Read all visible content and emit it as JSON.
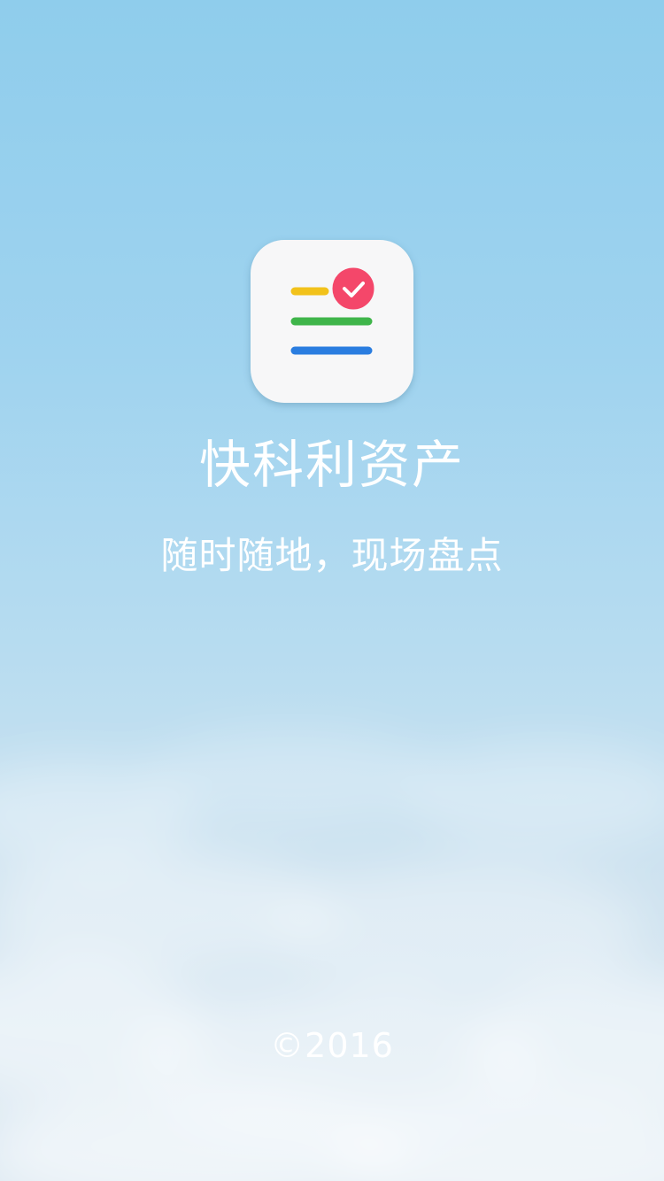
{
  "splash": {
    "app_name": "快科利资产",
    "slogan": "随时随地，现场盘点",
    "copyright": "©2016"
  },
  "logo": {
    "icon": "checklist-icon",
    "check_icon": "check-circle-icon",
    "colors": {
      "tile": "#f7f7f8",
      "line_top": "#f2c21b",
      "line_middle": "#3fb54a",
      "line_bottom": "#2a7de0",
      "check_badge": "#f4476a"
    }
  },
  "theme": {
    "sky_top": "#8fcdec",
    "sky_bottom": "#dde9f2",
    "text": "#ffffff"
  }
}
